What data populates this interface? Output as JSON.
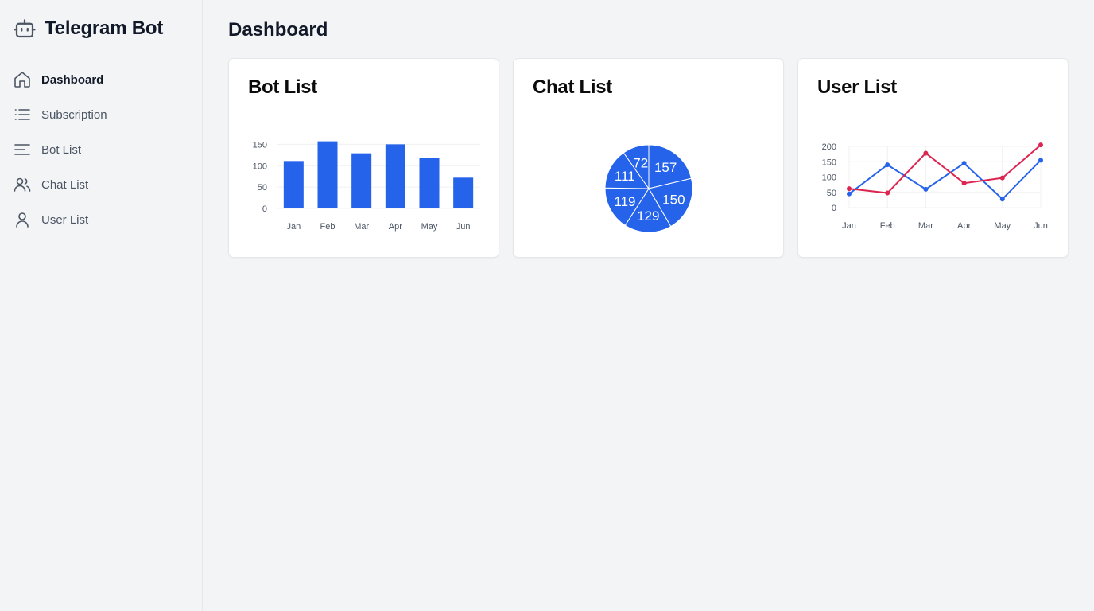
{
  "app": {
    "title": "Telegram Bot"
  },
  "sidebar": {
    "items": [
      {
        "label": "Dashboard",
        "icon": "home-icon",
        "active": true
      },
      {
        "label": "Subscription",
        "icon": "list-icon",
        "active": false
      },
      {
        "label": "Bot List",
        "icon": "menu-lines-icon",
        "active": false
      },
      {
        "label": "Chat List",
        "icon": "users-icon",
        "active": false
      },
      {
        "label": "User List",
        "icon": "user-icon",
        "active": false
      }
    ]
  },
  "main": {
    "title": "Dashboard",
    "cards": [
      {
        "title": "Bot List"
      },
      {
        "title": "Chat List"
      },
      {
        "title": "User List"
      }
    ]
  },
  "colors": {
    "primary": "#2563eb",
    "secondary": "#dc2651",
    "grid": "#f0f0f0"
  },
  "chart_data": [
    {
      "type": "bar",
      "categories": [
        "Jan",
        "Feb",
        "Mar",
        "Apr",
        "May",
        "Jun"
      ],
      "values": [
        111,
        157,
        129,
        150,
        119,
        72
      ],
      "yticks": [
        0,
        50,
        100,
        150
      ],
      "ylim": [
        0,
        160
      ],
      "grid": true
    },
    {
      "type": "pie",
      "values": [
        157,
        150,
        129,
        119,
        111,
        72
      ],
      "labels": [
        "157",
        "150",
        "129",
        "119",
        "111",
        "72"
      ]
    },
    {
      "type": "line",
      "categories": [
        "Jan",
        "Feb",
        "Mar",
        "Apr",
        "May",
        "Jun"
      ],
      "series": [
        {
          "values": [
            45,
            140,
            60,
            145,
            28,
            155
          ],
          "color": "#2563eb"
        },
        {
          "values": [
            62,
            48,
            178,
            80,
            97,
            205
          ],
          "color": "#dc2651"
        }
      ],
      "yticks": [
        0,
        50,
        100,
        150,
        200
      ],
      "ylim": [
        0,
        200
      ],
      "grid": true
    }
  ]
}
